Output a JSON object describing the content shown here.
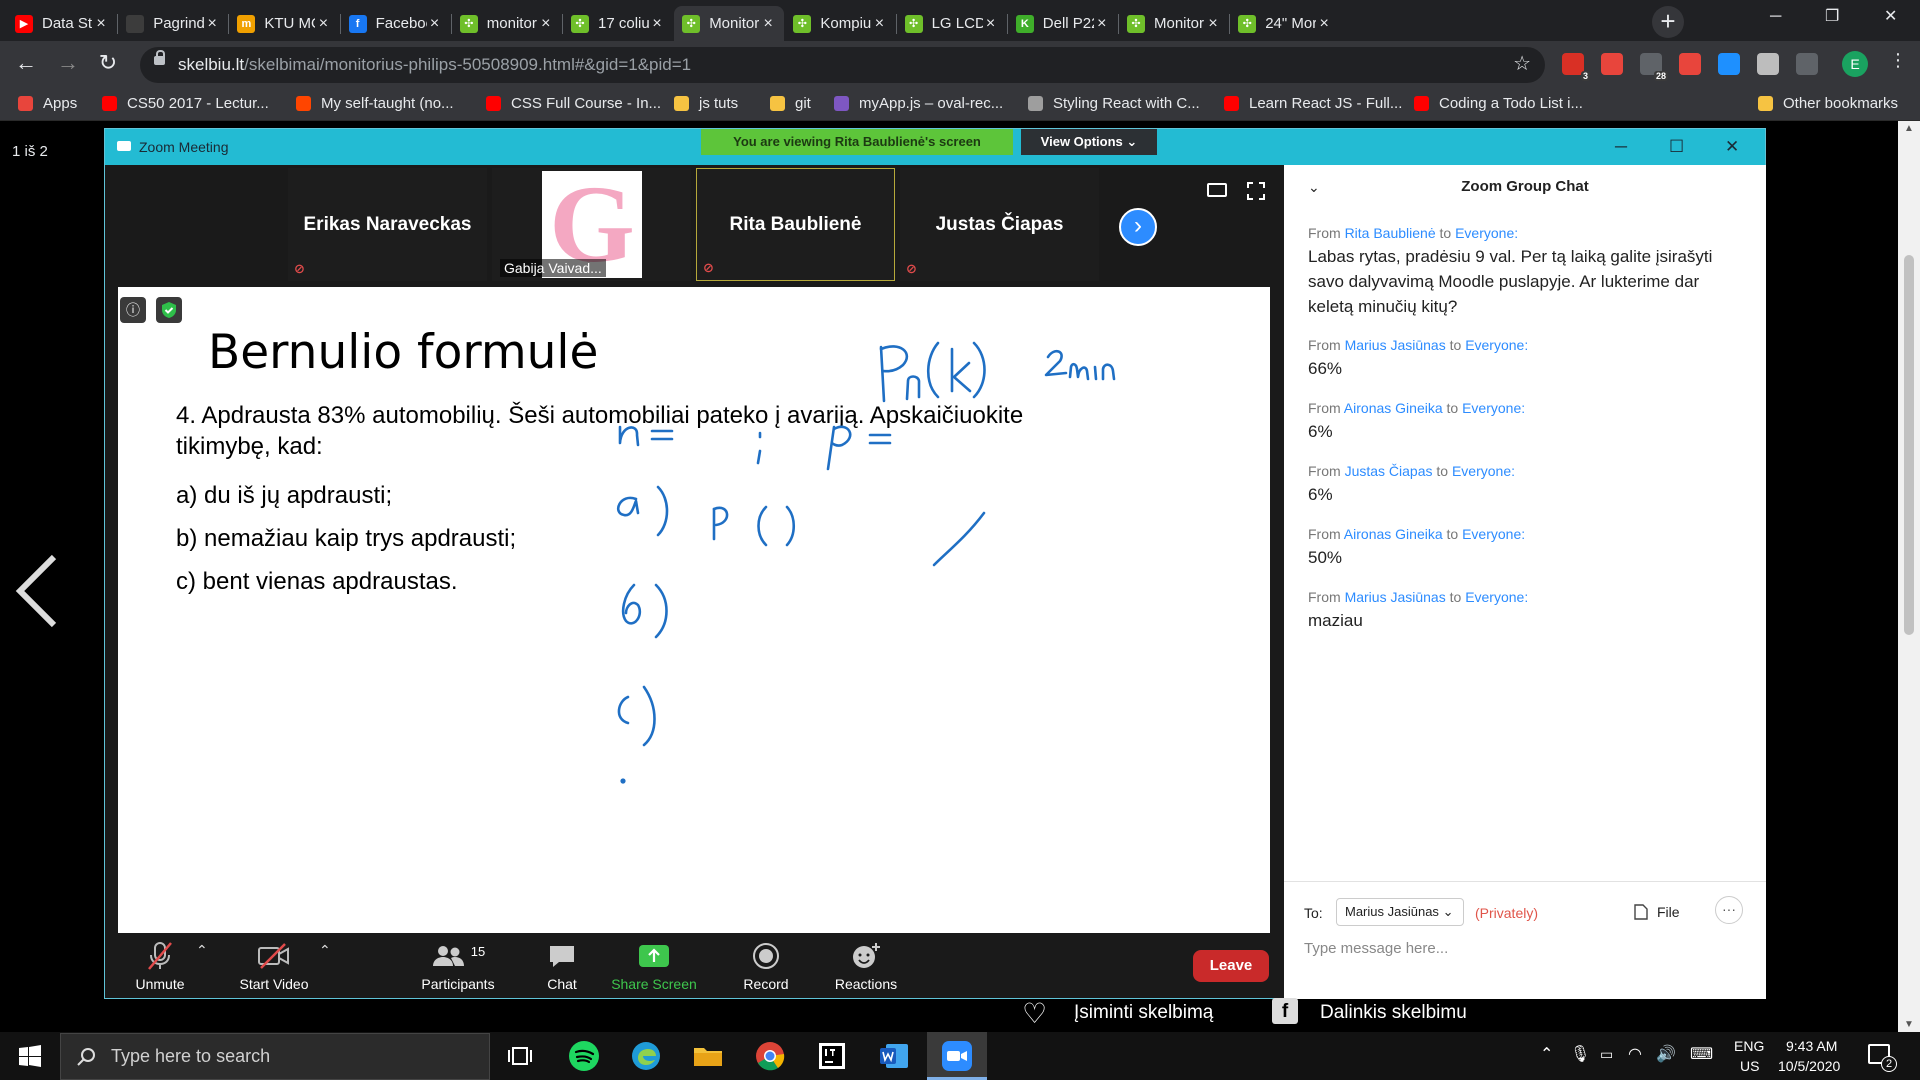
{
  "browser": {
    "tabs": [
      {
        "label": "Data Str",
        "fav_color": "#ff0000",
        "fav_text": "▶"
      },
      {
        "label": "Pagrindi",
        "fav_color": "#3c3c3c",
        "fav_text": ""
      },
      {
        "label": "KTU MO",
        "fav_color": "#f0a000",
        "fav_text": "m"
      },
      {
        "label": "Faceboo",
        "fav_color": "#1877f2",
        "fav_text": "f"
      },
      {
        "label": "monitor",
        "fav_color": "#6fbf2a",
        "fav_text": "✣"
      },
      {
        "label": "17 coliu",
        "fav_color": "#6fbf2a",
        "fav_text": "✣"
      },
      {
        "label": "Monitor",
        "fav_color": "#6fbf2a",
        "fav_text": "✣"
      },
      {
        "label": "Kompiut",
        "fav_color": "#6fbf2a",
        "fav_text": "✣"
      },
      {
        "label": "LG LCD",
        "fav_color": "#6fbf2a",
        "fav_text": "✣"
      },
      {
        "label": "Dell P22",
        "fav_color": "#3fae2a",
        "fav_text": "K"
      },
      {
        "label": "Monitor",
        "fav_color": "#6fbf2a",
        "fav_text": "✣"
      },
      {
        "label": "24\" Mor",
        "fav_color": "#6fbf2a",
        "fav_text": "✣"
      }
    ],
    "active_tab": 6,
    "url_host": "skelbiu.lt",
    "url_path": "/skelbimai/monitorius-philips-50508909.html#&gid=1&pid=1",
    "extensions": [
      {
        "name": "adblock-icon",
        "badge": "3",
        "color": "#d93025"
      },
      {
        "name": "pdf-icon",
        "badge": "",
        "color": "#e8453c"
      },
      {
        "name": "mail-icon",
        "badge": "28",
        "color": "#5f6368"
      },
      {
        "name": "video-icon",
        "badge": "",
        "color": "#e8453c"
      },
      {
        "name": "vpn-icon",
        "badge": "",
        "color": "#1e90ff"
      },
      {
        "name": "db-icon",
        "badge": "",
        "color": "#bdbdbd"
      },
      {
        "name": "puzzle-icon",
        "badge": "",
        "color": "#5f6368"
      }
    ],
    "profile_initial": "E",
    "bookmarks": [
      {
        "label": "Apps",
        "color": "#e8453c"
      },
      {
        "label": "CS50 2017 - Lectur...",
        "color": "#ff0000"
      },
      {
        "label": "My self-taught (no...",
        "color": "#ff4500"
      },
      {
        "label": "CSS Full Course - In...",
        "color": "#ff0000"
      },
      {
        "label": "js tuts",
        "color": "#f6c342"
      },
      {
        "label": "git",
        "color": "#f6c342"
      },
      {
        "label": "myApp.js – oval-rec...",
        "color": "#7e57c2"
      },
      {
        "label": "Styling React with C...",
        "color": "#9e9e9e"
      },
      {
        "label": "Learn React JS - Full...",
        "color": "#ff0000"
      },
      {
        "label": "Coding a Todo List i...",
        "color": "#ff0000"
      }
    ],
    "other_bookmarks": "Other bookmarks"
  },
  "gallery": {
    "counter": "1 iš 2"
  },
  "zoom": {
    "window_title": "Zoom Meeting",
    "viewing_banner": "You are viewing Rita Baublienė's screen",
    "view_options": "View Options",
    "participants": [
      {
        "name": "Erikas Naraveckas",
        "has_picture": false,
        "caption": ""
      },
      {
        "name": "",
        "has_picture": true,
        "picture_letter": "G",
        "caption": "Gabija Vaivad..."
      },
      {
        "name": "Rita Baublienė",
        "has_picture": false,
        "caption": ""
      },
      {
        "name": "Justas Čiapas",
        "has_picture": false,
        "caption": ""
      }
    ],
    "slide": {
      "title": "Bernulio formulė",
      "problem": "4. Apdrausta 83% automobilių. Šeši automobiliai pateko į avariją. Apskaičiuokite tikimybę, kad:",
      "items": [
        "a) du iš jų apdrausti;",
        "b) nemažiau kaip trys apdrausti;",
        "c) bent vienas apdraustas."
      ]
    },
    "controls": {
      "unmute": "Unmute",
      "start_video": "Start Video",
      "participants": "Participants",
      "participants_count": "15",
      "chat": "Chat",
      "share_screen": "Share Screen",
      "record": "Record",
      "reactions": "Reactions",
      "leave": "Leave"
    },
    "chat": {
      "title": "Zoom Group Chat",
      "from_word": "From",
      "to_word": "to",
      "messages": [
        {
          "from": "Rita Baublienė",
          "to": "Everyone:",
          "text": "Labas rytas, pradėsiu 9 val. Per tą laiką galite įsirašyti savo dalyvavimą Moodle puslapyje. Ar lukterime dar keletą minučių kitų?"
        },
        {
          "from": "Marius Jasiūnas",
          "to": "Everyone:",
          "text": "66%"
        },
        {
          "from": "Aironas Gineika",
          "to": "Everyone:",
          "text": "6%"
        },
        {
          "from": "Justas Čiapas",
          "to": "Everyone:",
          "text": "6%"
        },
        {
          "from": "Aironas Gineika",
          "to": "Everyone:",
          "text": "50%"
        },
        {
          "from": "Marius Jasiūnas",
          "to": "Everyone:",
          "text": "maziau"
        }
      ],
      "to_label": "To:",
      "recipient": "Marius Jasiūnas",
      "privately": "(Privately)",
      "file": "File",
      "placeholder": "Type message here..."
    }
  },
  "page_below": {
    "save_label": "Įsiminti skelbimą",
    "share_label": "Dalinkis skelbimu"
  },
  "taskbar": {
    "search_placeholder": "Type here to search",
    "lang_top": "ENG",
    "lang_bottom": "US",
    "time": "9:43 AM",
    "date": "10/5/2020",
    "notifications": "2"
  }
}
